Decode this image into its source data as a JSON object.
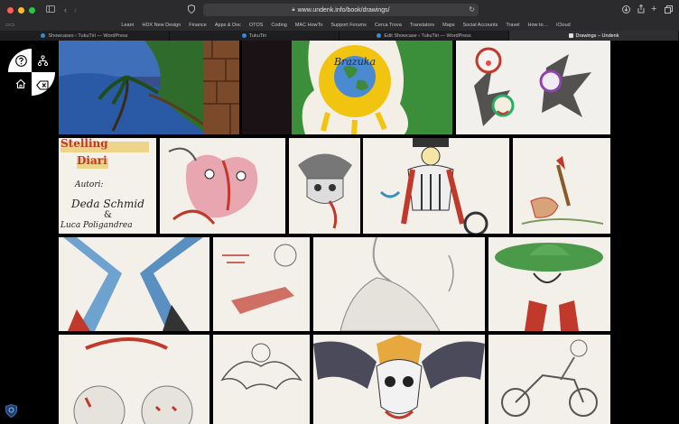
{
  "browser": {
    "url": "www.undenk.info/book/drawings/",
    "bookmarks": [
      "Learn",
      "HDX New Design",
      "Finance",
      "Apps & Doc",
      "OTOS",
      "Coding",
      "MAC HowTo",
      "Support Forums",
      "Cerca Trova",
      "Translators",
      "Maps",
      "Social Accounts",
      "Travel",
      "How to…",
      "iCloud"
    ],
    "tabs": [
      {
        "label": "Showcases ‹ TukuTiri — WordPress",
        "active": false
      },
      {
        "label": "TukuTiri",
        "active": false
      },
      {
        "label": "Edit Showcase ‹ TukuTiri — WordPress",
        "active": false
      },
      {
        "label": "Drawings – Undenk",
        "active": true
      }
    ],
    "colors": {
      "close": "#ff5f57",
      "minimize": "#febc2e",
      "zoom": "#28c840"
    }
  },
  "page": {
    "widget": {
      "icons": [
        "help-icon",
        "sitemap-icon",
        "home-icon",
        "backspace-icon"
      ]
    },
    "drawing_text": {
      "title_line1": "Stelling",
      "title_line2": "Diari",
      "authors_label": "Autori:",
      "author1": "Deda Schmid",
      "ampersand": "&",
      "author2": "Luca Poligandrea",
      "brazuka": "Brazuka"
    }
  }
}
